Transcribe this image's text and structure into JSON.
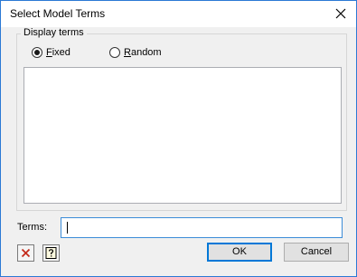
{
  "window": {
    "title": "Select Model Terms"
  },
  "display_terms": {
    "group_label": "Display terms",
    "options": [
      {
        "mnemonic": "F",
        "rest": "ixed",
        "selected": true
      },
      {
        "mnemonic": "R",
        "rest": "andom",
        "selected": false
      }
    ]
  },
  "terms_list": {
    "items": []
  },
  "terms": {
    "label": "Terms:",
    "value": ""
  },
  "buttons": {
    "ok": "OK",
    "cancel": "Cancel"
  },
  "icons": {
    "clear": "clear-x-icon",
    "help": "help-question-icon"
  },
  "colors": {
    "window_border": "#2b79d5",
    "clear_icon": "#c42b1c",
    "focus_border": "#0078d7"
  }
}
